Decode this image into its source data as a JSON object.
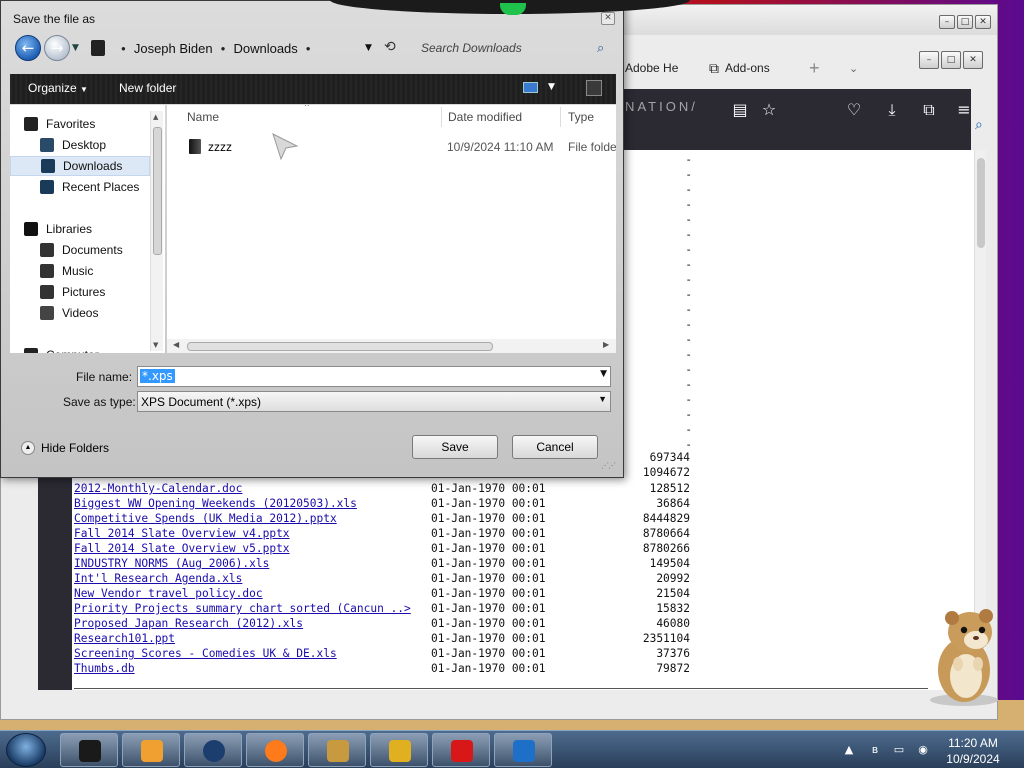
{
  "dialog": {
    "title": "Save the file as",
    "breadcrumb": [
      "Joseph Biden",
      "Downloads"
    ],
    "search_placeholder": "Search Downloads",
    "toolbar": {
      "organize": "Organize",
      "new_folder": "New folder"
    },
    "nav_items": [
      {
        "label": "Favorites",
        "icon": "star-icon",
        "selected": false
      },
      {
        "label": "Desktop",
        "icon": "desktop-icon",
        "selected": false
      },
      {
        "label": "Downloads",
        "icon": "downloads-icon",
        "selected": true
      },
      {
        "label": "Recent Places",
        "icon": "recent-places-icon",
        "selected": false
      },
      {
        "label": "Libraries",
        "icon": "libraries-icon",
        "selected": false
      },
      {
        "label": "Documents",
        "icon": "documents-icon",
        "selected": false
      },
      {
        "label": "Music",
        "icon": "music-icon",
        "selected": false
      },
      {
        "label": "Pictures",
        "icon": "pictures-icon",
        "selected": false
      },
      {
        "label": "Videos",
        "icon": "videos-icon",
        "selected": false
      },
      {
        "label": "Computer",
        "icon": "computer-icon",
        "selected": false
      }
    ],
    "columns": {
      "name": "Name",
      "date_modified": "Date modified",
      "type": "Type"
    },
    "files": [
      {
        "name": "zzzz",
        "date_modified": "10/9/2024 11:10 AM",
        "type": "File folde"
      }
    ],
    "file_name_label": "File name:",
    "file_name_value": "*.xps",
    "save_as_type_label": "Save as type:",
    "save_as_type_value": "XPS Document (*.xps)",
    "hide_folders": "Hide Folders",
    "save_button": "Save",
    "cancel_button": "Cancel"
  },
  "browser": {
    "tabs": [
      {
        "label": "Adobe He",
        "icon": "adobe-icon"
      },
      {
        "label": "Add-ons",
        "icon": "puzzle-icon"
      }
    ],
    "new_tab_icon": "plus-icon",
    "url_fragment": "ERNATION/",
    "nav_icons": [
      "reader-view-icon",
      "bookmark-star-icon",
      "pocket-icon",
      "download-icon",
      "extensions-icon",
      "menu-icon"
    ],
    "listing": {
      "dash_rows": [
        "-",
        "-",
        "-",
        "-",
        "-",
        "-",
        "-",
        "-",
        "-",
        "-",
        "-",
        "-",
        "-",
        "-",
        "-",
        "-",
        "-",
        "-",
        "-",
        "-"
      ],
      "partial_rows": [
        {
          "size": "697344"
        },
        {
          "size": "1094672"
        }
      ],
      "rows": [
        {
          "name": "2012-Monthly-Calendar.doc",
          "date": "01-Jan-1970 00:01",
          "size": "128512"
        },
        {
          "name": "Biggest WW Opening Weekends (20120503).xls",
          "date": "01-Jan-1970 00:01",
          "size": "36864"
        },
        {
          "name": "Competitive Spends (UK Media 2012).pptx",
          "date": "01-Jan-1970 00:01",
          "size": "8444829"
        },
        {
          "name": "Fall 2014 Slate Overview v4.pptx",
          "date": "01-Jan-1970 00:01",
          "size": "8780664"
        },
        {
          "name": "Fall 2014 Slate Overview v5.pptx",
          "date": "01-Jan-1970 00:01",
          "size": "8780266"
        },
        {
          "name": "INDUSTRY NORMS (Aug 2006).xls",
          "date": "01-Jan-1970 00:01",
          "size": "149504"
        },
        {
          "name": "Int'l Research Agenda.xls",
          "date": "01-Jan-1970 00:01",
          "size": "20992"
        },
        {
          "name": "New Vendor travel policy.doc",
          "date": "01-Jan-1970 00:01",
          "size": "21504"
        },
        {
          "name": "Priority Projects summary chart sorted (Cancun ..>",
          "date": "01-Jan-1970 00:01",
          "size": "15832"
        },
        {
          "name": "Proposed Japan Research (2012).xls",
          "date": "01-Jan-1970 00:01",
          "size": "46080"
        },
        {
          "name": "Research101.ppt",
          "date": "01-Jan-1970 00:01",
          "size": "2351104"
        },
        {
          "name": "Screening Scores - Comedies UK & DE.xls",
          "date": "01-Jan-1970 00:01",
          "size": "37376"
        },
        {
          "name": "Thumbs.db",
          "date": "01-Jan-1970 00:01",
          "size": "79872"
        }
      ]
    }
  },
  "taskbar": {
    "time": "11:20 AM",
    "date": "10/9/2024",
    "apps": [
      {
        "name": "explorer",
        "icon": "explorer-icon",
        "color": "#1a1a1a"
      },
      {
        "name": "media-player",
        "icon": "media-player-icon",
        "color": "#f0a030"
      },
      {
        "name": "globe",
        "icon": "globe-icon",
        "color": "#1c3e6e"
      },
      {
        "name": "firefox",
        "icon": "firefox-icon",
        "color": "#ff7a1a"
      },
      {
        "name": "hamster-box",
        "icon": "box-icon",
        "color": "#c89a40"
      },
      {
        "name": "archive",
        "icon": "winrar-icon",
        "color": "#e0b020"
      },
      {
        "name": "adobe-reader",
        "icon": "adobe-reader-icon",
        "color": "#d81818"
      },
      {
        "name": "tablet",
        "icon": "tablet-icon",
        "color": "#1e6fc8"
      }
    ]
  },
  "colors": {
    "accent": "#3399ff",
    "link": "#1a0dab",
    "toolbar": "#1f1f1f",
    "browser_nav": "#2b2a33"
  }
}
